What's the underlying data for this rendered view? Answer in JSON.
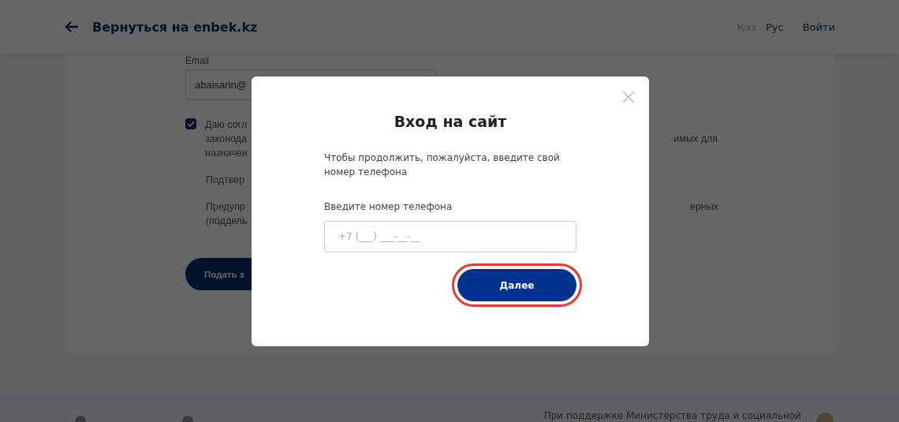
{
  "header": {
    "back_link": "Вернуться на enbek.kz",
    "languages": [
      {
        "label": "Қаз",
        "selected": false
      },
      {
        "label": "Рус",
        "selected": true
      }
    ],
    "login": "Войти"
  },
  "form": {
    "email_label": "Email",
    "email_value": "abaisarin@",
    "consent": {
      "checked": true,
      "lines": [
        {
          "left": "Даю согл"
        },
        {
          "left": "законода",
          "right": "имых для"
        },
        {
          "left": "назначен"
        }
      ]
    },
    "confirm_lines": [
      {
        "left": "Подтвер"
      }
    ],
    "warning_lines": [
      {
        "left": "Предупр",
        "right": "ерных"
      },
      {
        "left": "(поддель"
      }
    ],
    "submit": "Подать з"
  },
  "footer": {
    "support_text": "При поддержке Министерства труда и социальной"
  },
  "modal": {
    "title": "Вход на сайт",
    "intro": "Чтобы продолжить, пожалуйста, введите свой номер телефона",
    "phone_label": "Введите номер телефона",
    "phone": {
      "placeholder": "+7 (___) ___-__-__"
    },
    "next_button": {
      "label": "Далее",
      "highlighted": true
    }
  }
}
